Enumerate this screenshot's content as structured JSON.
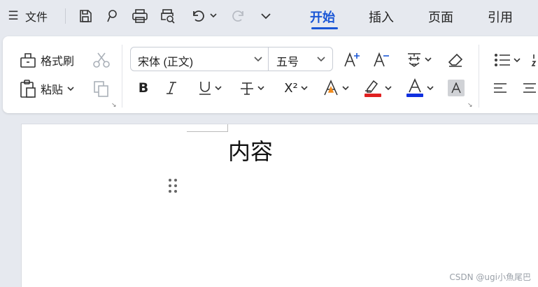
{
  "topbar": {
    "menu_icon": "☰",
    "file_label": "文件",
    "quick_access": [
      "save-icon",
      "format-painter-icon",
      "print-icon",
      "print-preview-icon",
      "undo-icon",
      "redo-icon",
      "more-icon"
    ],
    "tabs": [
      {
        "label": "开始",
        "active": true
      },
      {
        "label": "插入",
        "active": false
      },
      {
        "label": "页面",
        "active": false
      },
      {
        "label": "引用",
        "active": false
      }
    ]
  },
  "ribbon": {
    "format_painter_label": "格式刷",
    "paste_label": "粘贴",
    "font_name": "宋体 (正文)",
    "font_size": "五号",
    "superscript_glyph": "X²",
    "highlight_color": "#e02020",
    "font_color": "#1030e0"
  },
  "document": {
    "content_text": "内容"
  },
  "watermark": "CSDN @ugi小魚尾巴"
}
